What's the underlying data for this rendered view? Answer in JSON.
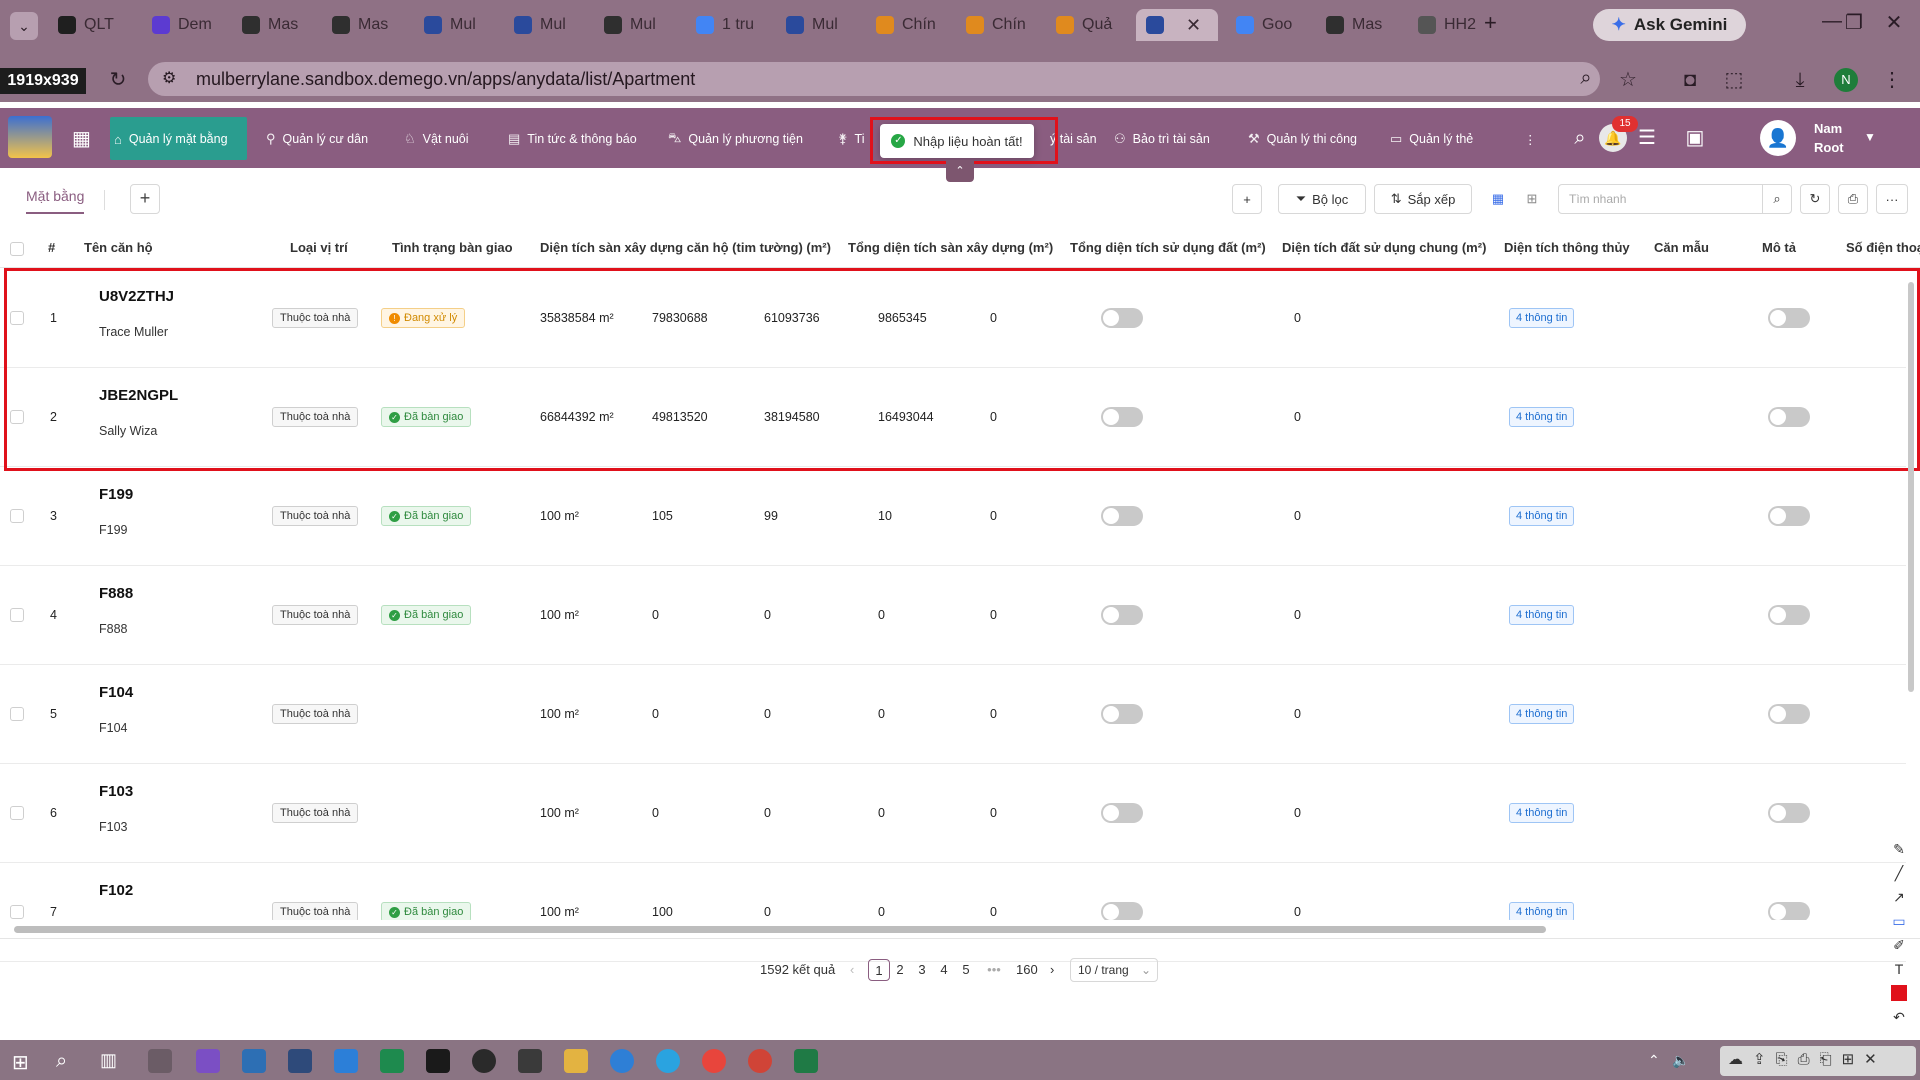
{
  "browser": {
    "tabs": [
      {
        "label": "QLT",
        "color": "#1f1f1f"
      },
      {
        "label": "Dem",
        "color": "#5c3bd1"
      },
      {
        "label": "Mas",
        "color": "#2f2f2f"
      },
      {
        "label": "Mas",
        "color": "#2f2f2f"
      },
      {
        "label": "Mul",
        "color": "#2a4a9c"
      },
      {
        "label": "Mul",
        "color": "#2a4a9c"
      },
      {
        "label": "Mul",
        "color": "#2f2f2f"
      },
      {
        "label": "1 tru",
        "color": "#4285f4"
      },
      {
        "label": "Mul",
        "color": "#2a4a9c"
      },
      {
        "label": "Chín",
        "color": "#e08a1e"
      },
      {
        "label": "Chín",
        "color": "#e08a1e"
      },
      {
        "label": "Quả",
        "color": "#e08a1e"
      },
      {
        "label": "",
        "color": "#2a4a9c"
      },
      {
        "label": "Goo",
        "color": "#4285f4"
      },
      {
        "label": "Mas",
        "color": "#2f2f2f"
      },
      {
        "label": "HH2",
        "color": "#555555"
      }
    ],
    "gemini_label": "Ask Gemini",
    "screen_dims": "1919x939",
    "url": "mulberrylane.sandbox.demego.vn/apps/anydata/list/Apartment",
    "profile_initial": "N"
  },
  "app": {
    "nav": [
      {
        "label": "Quản lý mặt bằng",
        "icon": "home-icon"
      },
      {
        "label": "Quản lý cư dân",
        "icon": "residents-icon"
      },
      {
        "label": "Vật nuôi",
        "icon": "pet-icon"
      },
      {
        "label": "Tin tức & thông báo",
        "icon": "news-icon"
      },
      {
        "label": "Quản lý phương tiện",
        "icon": "car-icon"
      },
      {
        "label": "Ti",
        "icon": "person-run-icon"
      },
      {
        "label": "ý tài sản",
        "icon": ""
      },
      {
        "label": "Bảo trì tài sản",
        "icon": "team-icon"
      },
      {
        "label": "Quản lý thi công",
        "icon": "construction-icon"
      },
      {
        "label": "Quản lý thẻ",
        "icon": "card-icon"
      }
    ],
    "toast": "Nhập liệu hoàn tất!",
    "notification_count": "15",
    "user": {
      "name": "Nam",
      "role": "Root"
    }
  },
  "toolbar": {
    "view_tab": "Mặt bằng",
    "filter_label": "Bộ lọc",
    "sort_label": "Sắp xếp",
    "search_placeholder": "Tìm nhanh"
  },
  "table": {
    "columns": [
      "#",
      "Tên căn hộ",
      "Loại vị trí",
      "Tình trạng bàn giao",
      "Diện tích sàn xây dựng căn hộ (tim tường) (m²)",
      "Tổng diện tích sàn xây dựng (m²)",
      "Tổng diện tích sử dụng đất (m²)",
      "Diện tích đất sử dụng chung (m²)",
      "Diện tích thông thủy",
      "Căn mẫu",
      "Mô tả",
      "Số điện thoạ"
    ],
    "rows": [
      {
        "no": "1",
        "code": "U8V2ZTHJ",
        "owner": "Trace Muller",
        "position": "Thuộc toà nhà",
        "status": "Đang xử lý",
        "status_type": "processing",
        "area": "35838584 m²",
        "v1": "79830688",
        "v2": "61093736",
        "v3": "9865345",
        "v4": "0",
        "v5": "0",
        "info": "4 thông tin"
      },
      {
        "no": "2",
        "code": "JBE2NGPL",
        "owner": "Sally Wiza",
        "position": "Thuộc toà nhà",
        "status": "Đã bàn giao",
        "status_type": "done",
        "area": "66844392 m²",
        "v1": "49813520",
        "v2": "38194580",
        "v3": "16493044",
        "v4": "0",
        "v5": "0",
        "info": "4 thông tin"
      },
      {
        "no": "3",
        "code": "F199",
        "owner": "F199",
        "position": "Thuộc toà nhà",
        "status": "Đã bàn giao",
        "status_type": "done",
        "area": "100 m²",
        "v1": "105",
        "v2": "99",
        "v3": "10",
        "v4": "0",
        "v5": "0",
        "info": "4 thông tin"
      },
      {
        "no": "4",
        "code": "F888",
        "owner": "F888",
        "position": "Thuộc toà nhà",
        "status": "Đã bàn giao",
        "status_type": "done",
        "area": "100 m²",
        "v1": "0",
        "v2": "0",
        "v3": "0",
        "v4": "0",
        "v5": "0",
        "info": "4 thông tin"
      },
      {
        "no": "5",
        "code": "F104",
        "owner": "F104",
        "position": "Thuộc toà nhà",
        "status": "",
        "status_type": "none",
        "area": "100 m²",
        "v1": "0",
        "v2": "0",
        "v3": "0",
        "v4": "0",
        "v5": "0",
        "info": "4 thông tin"
      },
      {
        "no": "6",
        "code": "F103",
        "owner": "F103",
        "position": "Thuộc toà nhà",
        "status": "",
        "status_type": "none",
        "area": "100 m²",
        "v1": "0",
        "v2": "0",
        "v3": "0",
        "v4": "0",
        "v5": "0",
        "info": "4 thông tin"
      },
      {
        "no": "7",
        "code": "F102",
        "owner": "",
        "position": "Thuộc toà nhà",
        "status": "Đã bàn giao",
        "status_type": "done",
        "area": "100 m²",
        "v1": "100",
        "v2": "0",
        "v3": "0",
        "v4": "0",
        "v5": "0",
        "info": "4 thông tin"
      }
    ]
  },
  "pagination": {
    "total": "1592 kết quả",
    "pages": [
      "1",
      "2",
      "3",
      "4",
      "5",
      "•••",
      "160"
    ],
    "current": "1",
    "page_size": "10 / trang"
  },
  "colors": {
    "brand": "#8a5d80",
    "nav_active": "#2a9d8f",
    "highlight": "#e0111b"
  }
}
